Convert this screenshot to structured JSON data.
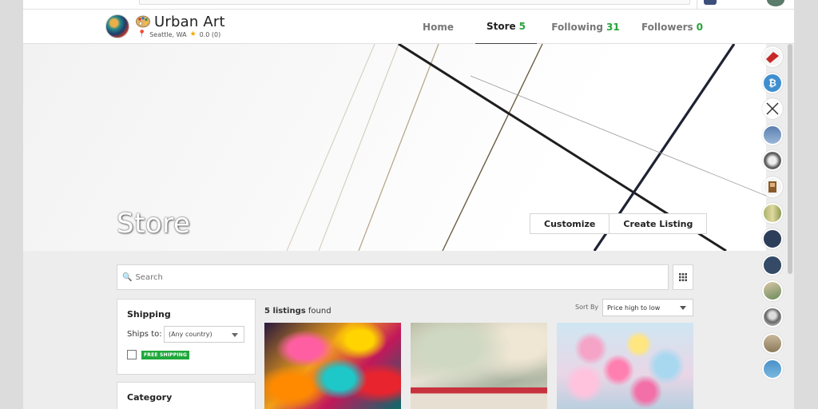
{
  "store": {
    "name": "Urban Art",
    "location": "Seattle, WA",
    "rating": "0.0 (0)"
  },
  "nav": {
    "items": [
      {
        "label": "Home",
        "count": ""
      },
      {
        "label": "Store",
        "count": "5"
      },
      {
        "label": "Following",
        "count": "31"
      },
      {
        "label": "Followers",
        "count": "0"
      }
    ],
    "active": "Store"
  },
  "banner": {
    "title": "Store",
    "customize_label": "Customize",
    "create_listing_label": "Create Listing"
  },
  "search": {
    "placeholder": "Search"
  },
  "filters": {
    "shipping_title": "Shipping",
    "ships_to_label": "Ships to:",
    "ships_to_value": "(Any country)",
    "free_shipping_badge": "FREE SHIPPING",
    "category_title": "Category"
  },
  "listings": {
    "count": "5 listings",
    "found_label": "found",
    "sort_label": "Sort By",
    "sort_value": "Price high to low",
    "cards": [
      {
        "name": "listing-card-1"
      },
      {
        "name": "listing-card-2"
      },
      {
        "name": "listing-card-3"
      }
    ]
  },
  "colors": {
    "count_green": "#27a33a",
    "badge_green": "#1fa83a",
    "star": "#f2a900",
    "pin": "#dd3333"
  },
  "icons": {
    "search": "search-icon",
    "grid": "grid-view-icon",
    "location": "pin-icon",
    "rating": "star-icon",
    "avatar_palette": "palette-icon"
  }
}
